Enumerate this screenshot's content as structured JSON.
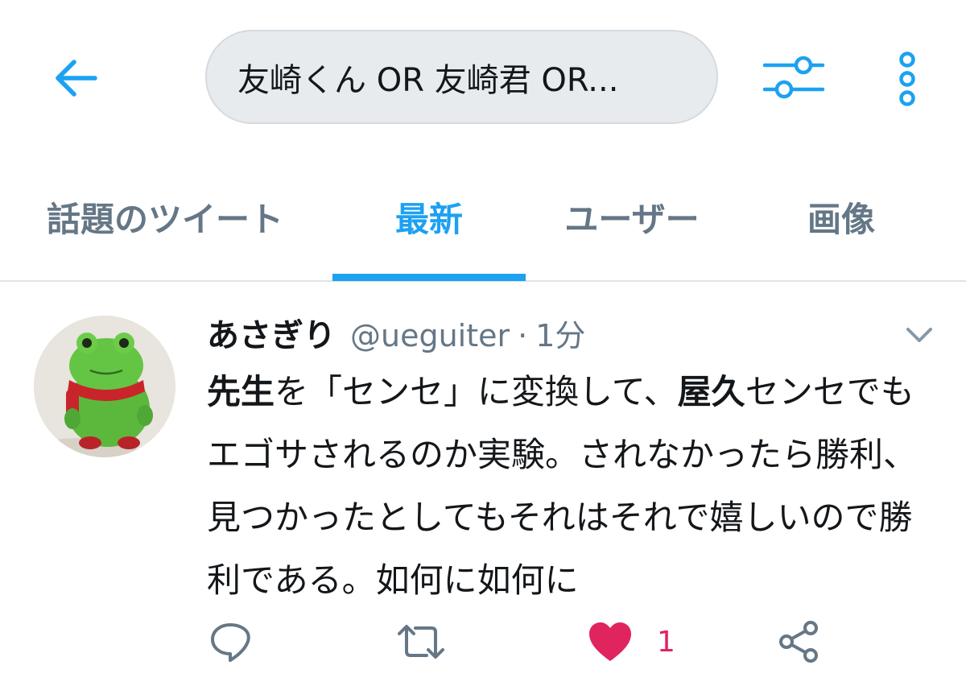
{
  "header": {
    "back_icon": "arrow-left-icon",
    "search_query": "友崎くん OR 友崎君 OR...",
    "filter_icon": "sliders-icon",
    "more_icon": "more-vertical-icon"
  },
  "tabs": [
    {
      "label": "話題のツイート",
      "active": false
    },
    {
      "label": "最新",
      "active": true
    },
    {
      "label": "ユーザー",
      "active": false
    },
    {
      "label": "画像",
      "active": false
    }
  ],
  "tweet": {
    "display_name": "あさぎり",
    "handle": "@ueguiter",
    "separator": "·",
    "time": "1分",
    "text": {
      "bold1": "先生",
      "part1": "を「センセ」に変換して、",
      "bold2": "屋久",
      "part2": "センセでもエゴサされるのか実験。されなかったら勝利、見つかったとしてもそれはそれで嬉しいので勝利である。如何に如何に"
    },
    "actions": {
      "reply_icon": "reply-icon",
      "retweet_icon": "retweet-icon",
      "like_icon": "heart-icon",
      "like_count": "1",
      "share_icon": "share-icon"
    }
  },
  "colors": {
    "accent": "#1da1f2",
    "like": "#e0245e",
    "muted": "#657786",
    "text": "#14171a",
    "search_bg": "#e7ebee"
  }
}
